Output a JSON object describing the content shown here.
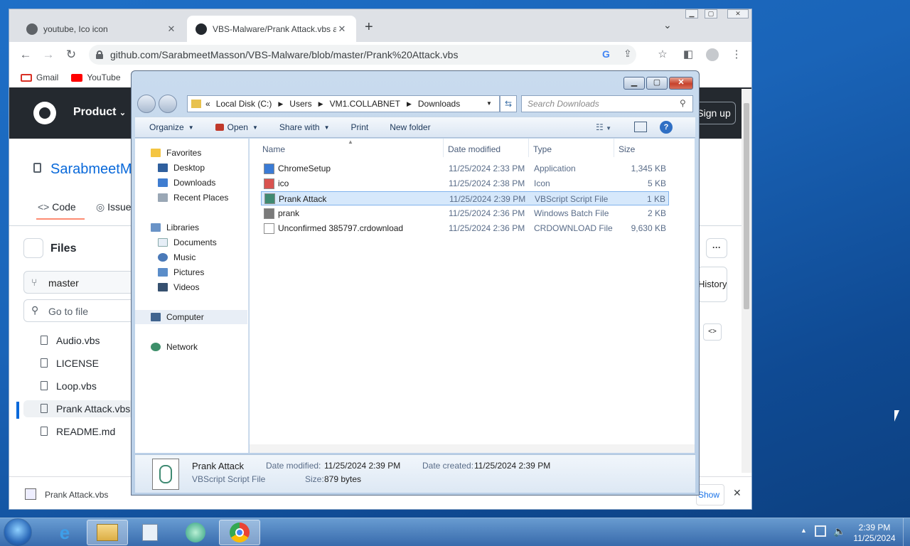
{
  "chrome": {
    "tabs": [
      {
        "title": "youtube, Ico icon",
        "close": "✕"
      },
      {
        "title": "VBS-Malware/Prank Attack.vbs at",
        "close": "✕"
      }
    ],
    "new_tab": "+",
    "tab_search": "⌄",
    "url": "github.com/SarabmeetMasson/VBS-Malware/blob/master/Prank%20Attack.vbs",
    "bookmarks": [
      {
        "label": "Gmail",
        "color": "#d93025"
      },
      {
        "label": "YouTube",
        "color": "#ff0000"
      }
    ]
  },
  "github": {
    "product": "Product",
    "repo": "SarabmeetMasson",
    "signup": "Sign up",
    "tabs": {
      "code": "Code",
      "issues": "Issues"
    },
    "files_title": "Files",
    "branch": "master",
    "go_to_file": "Go to file",
    "files": [
      "Audio.vbs",
      "LICENSE",
      "Loop.vbs",
      "Prank Attack.vbs",
      "README.md"
    ],
    "history": "History",
    "download_bar": {
      "file": "Prank Attack.vbs",
      "show_all": "Show all"
    }
  },
  "explorer": {
    "breadcrumb": [
      "Local Disk (C:)",
      "Users",
      "VM1.COLLABNET",
      "Downloads"
    ],
    "search_placeholder": "Search Downloads",
    "commands": [
      "Organize",
      "Open",
      "Share with",
      "Print",
      "New folder"
    ],
    "nav": {
      "favorites": "Favorites",
      "favorites_items": [
        "Desktop",
        "Downloads",
        "Recent Places"
      ],
      "libraries": "Libraries",
      "libraries_items": [
        "Documents",
        "Music",
        "Pictures",
        "Videos"
      ],
      "computer": "Computer",
      "network": "Network"
    },
    "columns": {
      "name": "Name",
      "date": "Date modified",
      "type": "Type",
      "size": "Size"
    },
    "files": [
      {
        "name": "ChromeSetup",
        "date": "11/25/2024 2:33 PM",
        "type": "Application",
        "size": "1,345 KB"
      },
      {
        "name": "ico",
        "date": "11/25/2024 2:38 PM",
        "type": "Icon",
        "size": "5 KB"
      },
      {
        "name": "Prank Attack",
        "date": "11/25/2024 2:39 PM",
        "type": "VBScript Script File",
        "size": "1 KB"
      },
      {
        "name": "prank",
        "date": "11/25/2024 2:36 PM",
        "type": "Windows Batch File",
        "size": "2 KB"
      },
      {
        "name": "Unconfirmed 385797.crdownload",
        "date": "11/25/2024 2:36 PM",
        "type": "CRDOWNLOAD File",
        "size": "9,630 KB"
      }
    ],
    "selected_index": 2,
    "details": {
      "name": "Prank Attack",
      "type": "VBScript Script File",
      "modified_label": "Date modified:",
      "modified": "11/25/2024 2:39 PM",
      "created_label": "Date created:",
      "created": "11/25/2024 2:39 PM",
      "size_label": "Size:",
      "size": "879 bytes"
    }
  },
  "taskbar": {
    "time": "2:39 PM",
    "date": "11/25/2024"
  }
}
